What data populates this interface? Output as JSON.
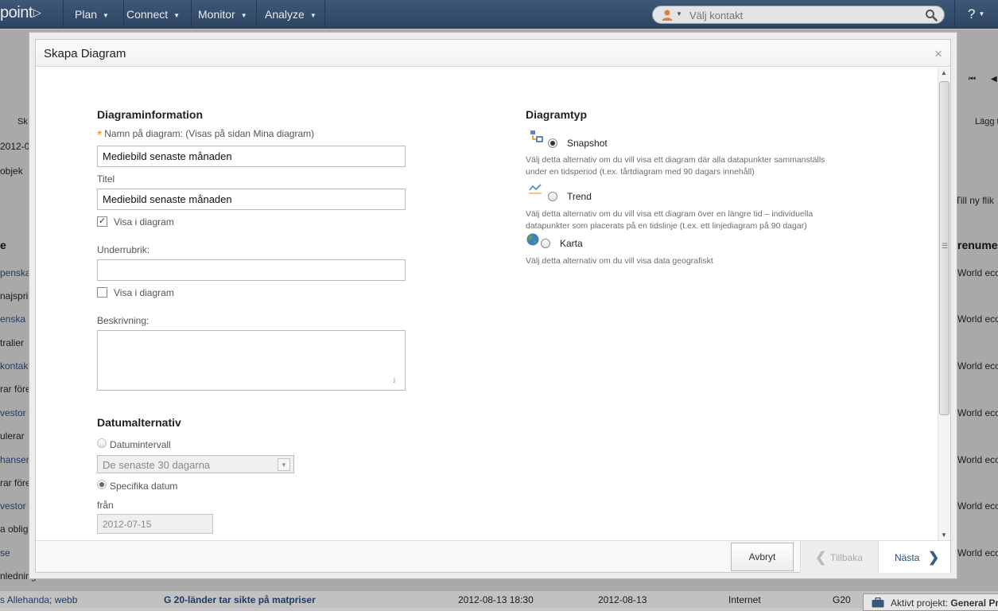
{
  "topbar": {
    "logo": "point",
    "nav": [
      {
        "label": "Plan"
      },
      {
        "label": "Connect"
      },
      {
        "label": "Monitor"
      },
      {
        "label": "Analyze"
      }
    ],
    "contact_placeholder": "Välj kontakt",
    "help": "?"
  },
  "background": {
    "tab_left": "Sk",
    "date_left": "2012-0",
    "objects": "objek",
    "add_tab": "Lägg t",
    "new_tab": "Till ny flik",
    "col_left": "e",
    "col_right": "renume",
    "rows_left": [
      "penska",
      "najspri",
      "enska",
      "tralier",
      "kontak",
      "rar före",
      "vestor",
      "ulerar",
      "hanser",
      "rar före",
      "vestor",
      "a oblig",
      "se",
      "nledning"
    ],
    "rows_right": [
      "World econ",
      "World econ",
      "World econ",
      "World econ",
      "World econ",
      "World econ",
      "World econ"
    ],
    "last_row": {
      "source": "s Allehanda; webb",
      "headline": "G 20-länder tar sikte på matpriser",
      "published": "2012-08-13 18:30",
      "date": "2012-08-13",
      "media": "Internet",
      "tag": "G20"
    },
    "active_project": "Aktivt projekt:",
    "active_project_name": "General Pr"
  },
  "modal": {
    "title": "Skapa Diagram",
    "close": "×",
    "info": {
      "heading": "Diagraminformation",
      "name_label": "Namn på diagram: (Visas på sidan Mina diagram)",
      "name_value": "Mediebild senaste månaden",
      "title_label": "Titel",
      "title_value": "Mediebild senaste månaden",
      "show_label": "Visa i diagram",
      "subtitle_label": "Underrubrik:",
      "subtitle_value": "",
      "description_label": "Beskrivning:"
    },
    "date": {
      "heading": "Datumalternativ",
      "interval_label": "Datumintervall",
      "interval_value": "De senaste 30 dagarna",
      "specific_label": "Specifika datum",
      "from_label": "från",
      "from_value": "2012-07-15"
    },
    "type": {
      "heading": "Diagramtyp",
      "options": [
        {
          "label": "Snapshot",
          "description": "Välj detta alternativ om du vill visa ett diagram där alla datapunkter sammanställs under en tidsperiod (t.ex. tårtdiagram med 90 dagars innehåll)"
        },
        {
          "label": "Trend",
          "description": "Välj detta alternativ om du vill visa ett diagram över en längre tid – individuella datapunkter som placerats på en tidslinje (t.ex. ett linjediagram på 90 dagar)"
        },
        {
          "label": "Karta",
          "description": "Välj detta alternativ om du vill visa data geografiskt"
        }
      ]
    },
    "footer": {
      "cancel": "Avbryt",
      "back": "Tillbaka",
      "next": "Nästa"
    }
  },
  "colors": {
    "nav_bg": "#34506f",
    "accent_star": "#f08a00",
    "link_blue": "#2a4d7a"
  }
}
